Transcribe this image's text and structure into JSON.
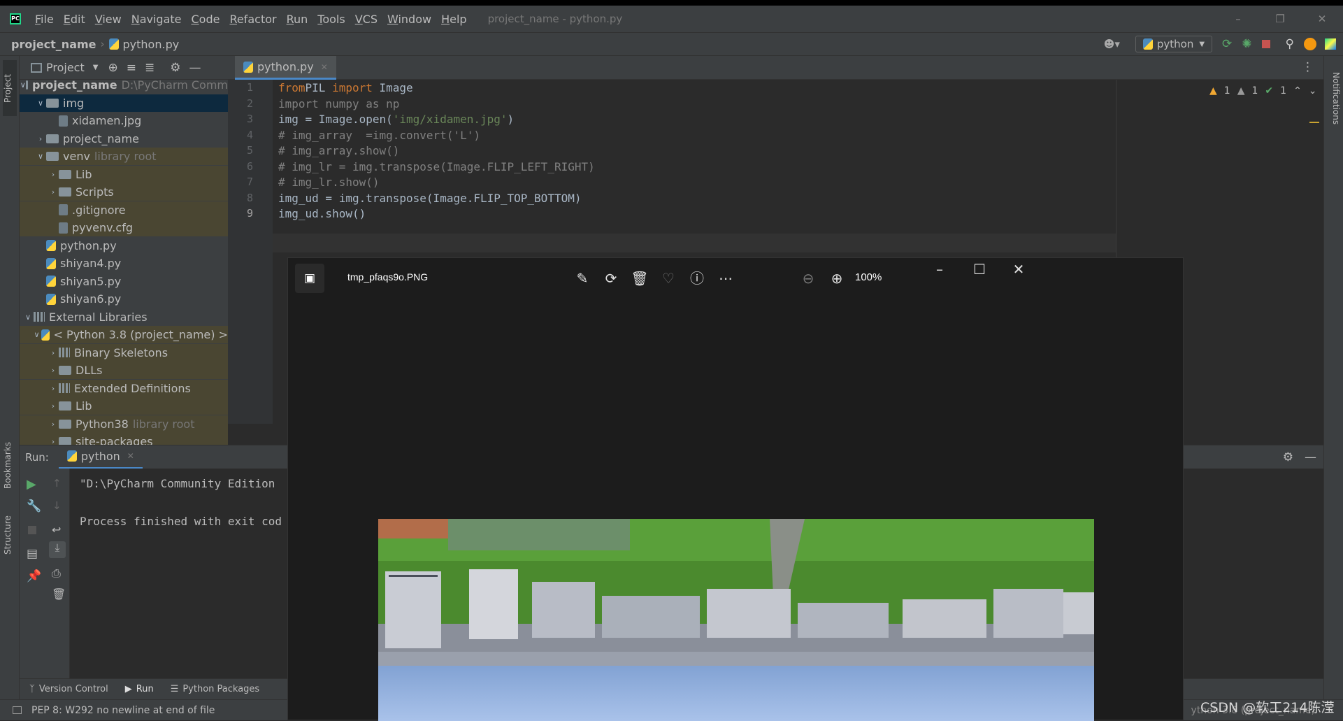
{
  "app": {
    "logo": "PC",
    "window_title": "project_name - python.py",
    "menu": [
      "File",
      "Edit",
      "View",
      "Navigate",
      "Code",
      "Refactor",
      "Run",
      "Tools",
      "VCS",
      "Window",
      "Help"
    ]
  },
  "nav": {
    "breadcrumb_project": "project_name",
    "breadcrumb_file": "python.py",
    "run_config": "python"
  },
  "project_panel": {
    "title": "Project",
    "tree": [
      {
        "label": "project_name",
        "extra": "D:\\PyCharm Comm",
        "type": "folder",
        "bold": true
      },
      {
        "label": "img",
        "extra": "",
        "type": "folder"
      },
      {
        "label": "xidamen.jpg",
        "extra": "",
        "type": "file"
      },
      {
        "label": "project_name",
        "extra": "",
        "type": "folder"
      },
      {
        "label": "venv",
        "extra": "library root",
        "type": "folder"
      },
      {
        "label": "Lib",
        "extra": "",
        "type": "folder"
      },
      {
        "label": "Scripts",
        "extra": "",
        "type": "folder"
      },
      {
        "label": ".gitignore",
        "extra": "",
        "type": "file"
      },
      {
        "label": "pyvenv.cfg",
        "extra": "",
        "type": "file"
      },
      {
        "label": "python.py",
        "extra": "",
        "type": "py"
      },
      {
        "label": "shiyan4.py",
        "extra": "",
        "type": "py"
      },
      {
        "label": "shiyan5.py",
        "extra": "",
        "type": "py"
      },
      {
        "label": "shiyan6.py",
        "extra": "",
        "type": "py"
      },
      {
        "label": "External Libraries",
        "extra": "",
        "type": "lib"
      },
      {
        "label": "< Python 3.8 (project_name) >",
        "extra": "",
        "type": "py"
      },
      {
        "label": "Binary Skeletons",
        "extra": "",
        "type": "lib"
      },
      {
        "label": "DLLs",
        "extra": "",
        "type": "folder"
      },
      {
        "label": "Extended Definitions",
        "extra": "",
        "type": "lib"
      },
      {
        "label": "Lib",
        "extra": "",
        "type": "folder"
      },
      {
        "label": "Python38",
        "extra": "library root",
        "type": "folder"
      },
      {
        "label": "site-packages",
        "extra": "",
        "type": "folder"
      }
    ]
  },
  "editor": {
    "tab": "python.py",
    "warnings": "1",
    "weak_warnings": "1",
    "typos": "1",
    "line_numbers": [
      "1",
      "2",
      "3",
      "4",
      "5",
      "6",
      "7",
      "8",
      "9"
    ]
  },
  "run_panel": {
    "label": "Run:",
    "tab": "python",
    "line1": "\"D:\\PyCharm Community Edition",
    "line2": "Process finished with exit cod"
  },
  "bottom_tabs": [
    "Version Control",
    "Run",
    "Python Packages"
  ],
  "status": {
    "message": "PEP 8: W292 no newline at end of file",
    "interpreter": "ython 3.8 (project_name)",
    "watermark": "CSDN @软工214陈滢"
  },
  "side_labels": {
    "project": "Project",
    "bookmarks": "Bookmarks",
    "structure": "Structure",
    "notifications": "Notifications"
  },
  "viewer": {
    "filename": "tmp_pfaqs9o.PNG",
    "zoom": "100%"
  }
}
